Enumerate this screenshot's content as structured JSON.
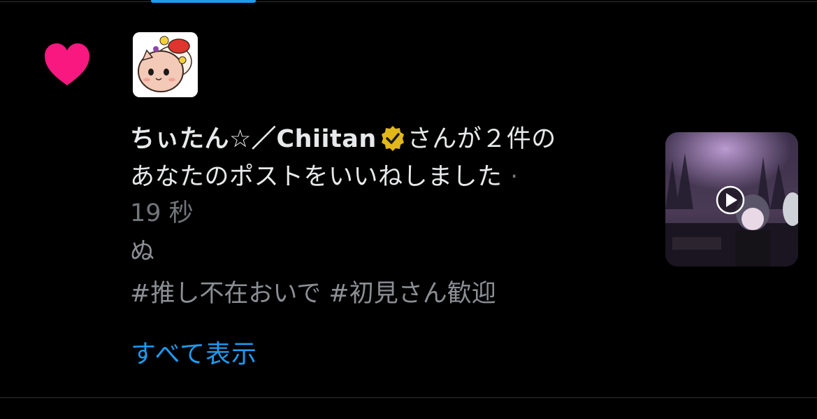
{
  "notification": {
    "type_icon": "heart-icon",
    "accent_color": "#f91880",
    "link_color": "#1d9bf0",
    "avatar_icon": "cat-avatar-icon",
    "name": "ちぃたん☆／Chiitan",
    "verified": true,
    "action_line1": "さんが２件の",
    "action_line2": "あなたのポストをいいねしました",
    "separator": "·",
    "time": "19 秒",
    "post_text": "ぬ",
    "hashtags": "#推し不在おいで #初見さん歓迎",
    "show_all": "すべて表示",
    "thumbnail_icon": "video-play-icon"
  }
}
